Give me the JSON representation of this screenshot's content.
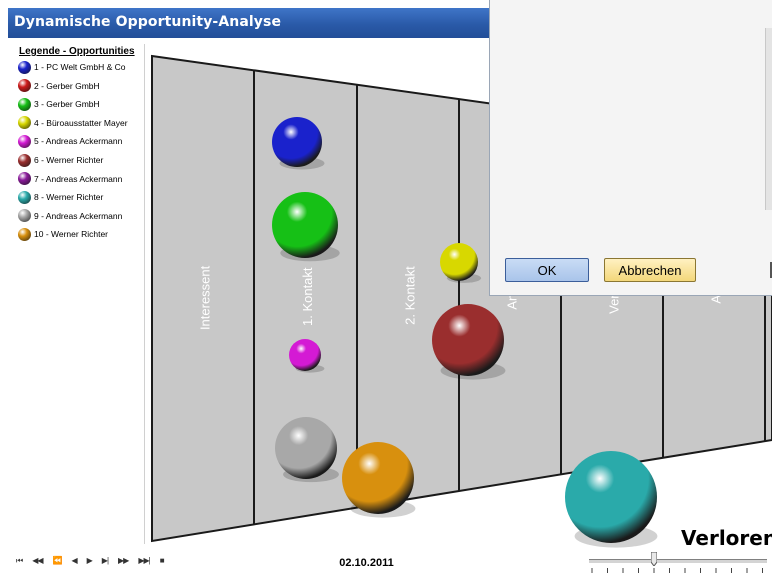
{
  "window": {
    "title": "Dynamische Opportunity-Analyse"
  },
  "legend": {
    "title": "Legende - Opportunities",
    "items": [
      {
        "label": "1 - PC Welt GmbH & Co",
        "color": "#1a22cc"
      },
      {
        "label": "2 - Gerber GmbH",
        "color": "#cc1a1a"
      },
      {
        "label": "3 - Gerber GmbH",
        "color": "#16c016"
      },
      {
        "label": "4 - Büroausstatter Mayer",
        "color": "#d8d800"
      },
      {
        "label": "5 - Andreas Ackermann",
        "color": "#d41ad4"
      },
      {
        "label": "6 - Werner Richter",
        "color": "#9a2e2e"
      },
      {
        "label": "7 - Andreas Ackermann",
        "color": "#8a1a9a"
      },
      {
        "label": "8 - Werner Richter",
        "color": "#2aaaaa"
      },
      {
        "label": "9 - Andreas Ackermann",
        "color": "#a8a8a8"
      },
      {
        "label": "10 - Werner Richter",
        "color": "#d8900e"
      }
    ]
  },
  "funnel": {
    "stages": [
      "Interessent",
      "1. Kontakt",
      "2. Kontakt",
      "Ange",
      "Verhan",
      "Auft"
    ],
    "fill_color": "#c8c8c8",
    "line_color": "#1a1a1a"
  },
  "bubbles": [
    {
      "opportunity": "1 - PC Welt GmbH & Co",
      "stage": "1. Kontakt",
      "color": "#1a22cc"
    },
    {
      "opportunity": "3 - Gerber GmbH",
      "stage": "1. Kontakt",
      "color": "#16c016"
    },
    {
      "opportunity": "5 - Andreas Ackermann",
      "stage": "1. Kontakt",
      "color": "#d41ad4"
    },
    {
      "opportunity": "9 - Andreas Ackermann",
      "stage": "1. Kontakt",
      "color": "#a8a8a8"
    },
    {
      "opportunity": "10 - Werner Richter",
      "stage": "1. Kontakt",
      "color": "#d8900e"
    },
    {
      "opportunity": "4 - Büroausstatter Mayer",
      "stage": "2. Kontakt",
      "color": "#d8d800"
    },
    {
      "opportunity": "6 - Werner Richter",
      "stage": "Ange",
      "color": "#9a2e2e"
    },
    {
      "opportunity": "8 - Werner Richter",
      "stage": "Verloren",
      "color": "#2aaaaa"
    }
  ],
  "lost_label": "Verloren",
  "dialog": {
    "ok_label": "OK",
    "cancel_label": "Abbrechen"
  },
  "playback": {
    "controls": [
      "first-icon",
      "rewind-fast-icon",
      "step-back-icon",
      "play-reverse-icon",
      "play-icon",
      "step-forward-icon",
      "fast-forward-icon",
      "last-icon",
      "stop-icon"
    ],
    "control_glyphs": [
      "⏮",
      "◀◀",
      "⏪",
      "◀",
      "▶",
      "▶|",
      "▶▶",
      "▶▶|",
      "■"
    ],
    "date": "02.10.2011"
  }
}
